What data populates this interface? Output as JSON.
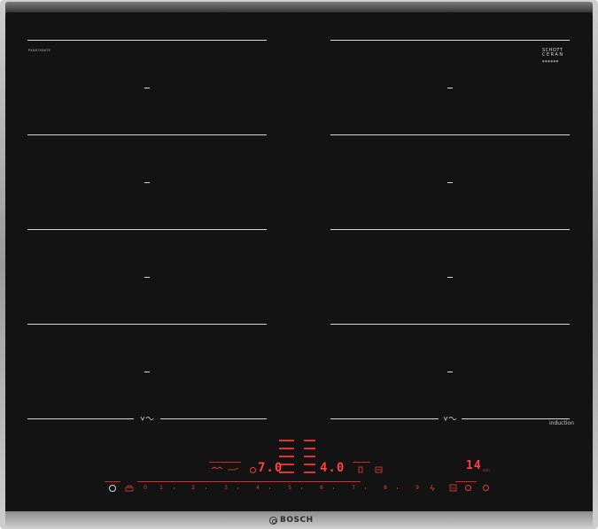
{
  "cooktop": {
    "model_number": "PXX875D67E",
    "glass_brand_line1": "SCHOTT",
    "glass_brand_line2": "CERAN",
    "glass_brand_sub": "●●●●●●",
    "induction_label": "induction",
    "brand": "BOSCH"
  },
  "controls": {
    "power_symbol": "⏻",
    "lock_symbol": "⊗",
    "scale": [
      "0",
      "1",
      "2",
      "3",
      "4",
      "5",
      "6",
      "7",
      "8",
      "9"
    ],
    "left_display": "7.0",
    "center_display": "4.0",
    "timer_display": "14",
    "timer_unit": "min"
  },
  "colors": {
    "glass": "#141313",
    "display_red": "#ff4040",
    "line": "#d8d8d8"
  }
}
